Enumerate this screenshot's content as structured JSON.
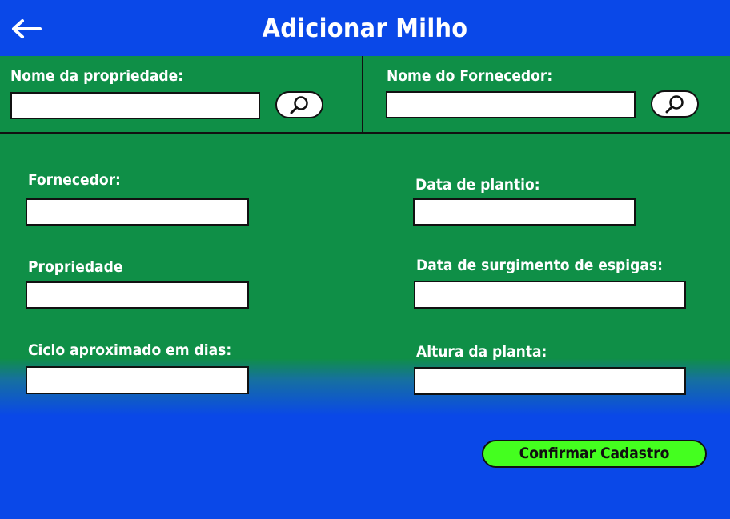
{
  "header": {
    "title": "Adicionar Milho"
  },
  "search": {
    "property_label": "Nome da propriedade:",
    "supplier_label": "Nome do Fornecedor:"
  },
  "form": {
    "fornecedor_label": "Fornecedor:",
    "propriedade_label": "Propriedade",
    "ciclo_label": "Ciclo aproximado em dias:",
    "data_plantio_label": "Data de plantio:",
    "data_espigas_label": "Data de surgimento de espigas:",
    "altura_label": "Altura da planta:"
  },
  "actions": {
    "confirm_label": "Confirmar Cadastro"
  },
  "colors": {
    "header_blue": "#0a48e8",
    "form_green": "#0f8f47",
    "button_green": "#44ff1f"
  }
}
